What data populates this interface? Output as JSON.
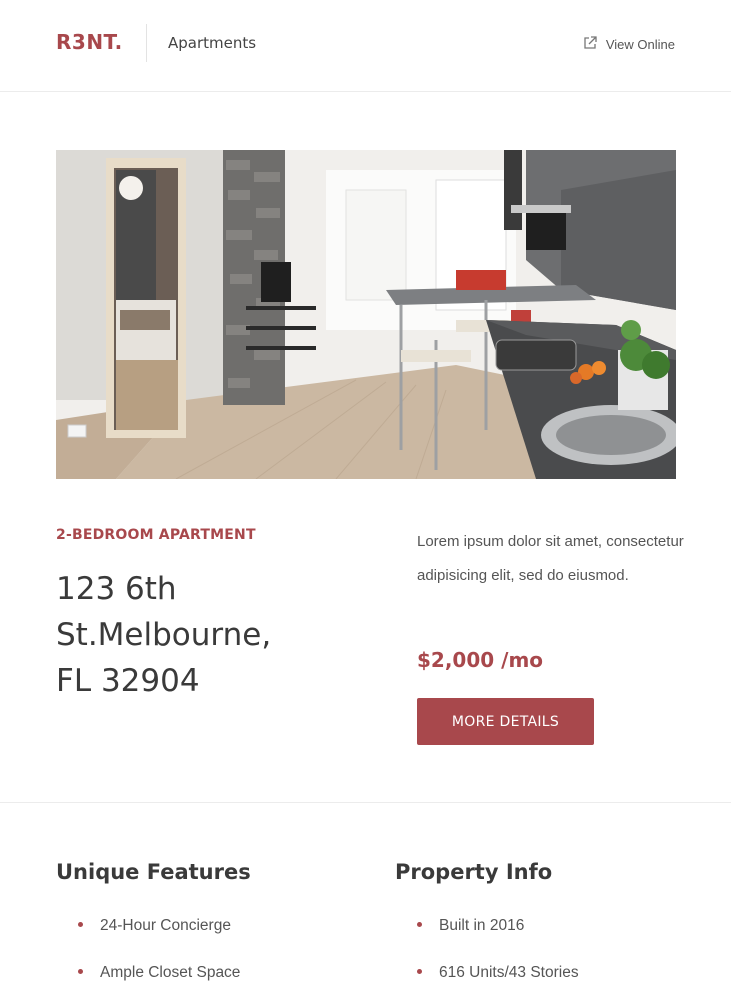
{
  "header": {
    "logo": "R3NT.",
    "section": "Apartments",
    "view_online": "View Online"
  },
  "hero": {
    "image": "apartment-interior-photo",
    "alt": "Apartment interior with kitchen and bedroom"
  },
  "listing": {
    "type": "2-BEDROOM APARTMENT",
    "address_lines": [
      "123 6th",
      "St.Melbourne,",
      "FL 32904"
    ],
    "description": "Lorem ipsum dolor sit amet, consectetur adipisicing elit, sed do eiusmod.",
    "price": "$2,000 /mo",
    "cta": "MORE DETAILS"
  },
  "features": {
    "title": "Unique Features",
    "items": [
      "24-Hour Concierge",
      "Ample Closet Space"
    ]
  },
  "property_info": {
    "title": "Property Info",
    "items": [
      "Built in 2016",
      "616 Units/43 Stories"
    ]
  },
  "colors": {
    "accent": "#a8484c",
    "text": "#3a3a3a"
  }
}
